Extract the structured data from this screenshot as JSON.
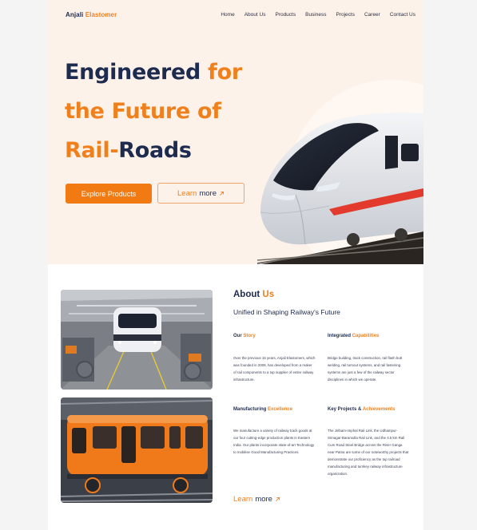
{
  "brand": {
    "part1": "Anjali",
    "part2": "Elastomer"
  },
  "nav": [
    "Home",
    "About Us",
    "Products",
    "Business",
    "Projects",
    "Career",
    "Contact Us"
  ],
  "hero": {
    "line1_a": "Engineered",
    "line1_b": "for",
    "line2": "the Future of",
    "line3_a": "Rail-",
    "line3_b": "Roads",
    "primary_button": "Explore Products",
    "secondary_a": "Learn",
    "secondary_b": "more"
  },
  "about": {
    "title_a": "About",
    "title_b": "Us",
    "subtitle": "Unified in Shaping Railway's Future",
    "cards": [
      {
        "title_a": "Our",
        "title_b": "Story",
        "text": "Over the previous 15 years, Anjali Elastomers, which was founded in 2009, has developed from a maker of rail components to a top supplier of entire railway infrastructure."
      },
      {
        "title_a": "Integrated",
        "title_b": "Capabilities",
        "text": "Bridge building, track construction, rail flash butt welding, rail turnout systems, and rail fastening systems are just a few of the railway sector disciplines in which we operate."
      },
      {
        "title_a": "Manufacturing",
        "title_b": "Excellence",
        "text": "We manufacture a variety of railway track goods at our four cutting-edge production plants in Eastern India. Our plants incorporate state-of-art Technology to mobilise Good Manufacturing Practices."
      },
      {
        "title_a": "Key Projects &",
        "title_b": "Achievements",
        "text": "The Jiribam-Imphal Rail Link, the Udhampur-Srinagar-Baramulla Rail Link, and the 4.5 km Rail Cum Road Steel Bridge across the River Ganga near Patna are some of our noteworthy projects that demonstrate our proficiency as the top railroad manufacturing and turnkey railway infrastructure organization."
      }
    ],
    "learn_a": "Learn",
    "learn_b": "more"
  },
  "colors": {
    "navy": "#1d2b4f",
    "orange": "#f0801c",
    "hero_bg": "#fdf2ea"
  },
  "icons": {
    "arrow": "arrow-up-right-icon"
  }
}
